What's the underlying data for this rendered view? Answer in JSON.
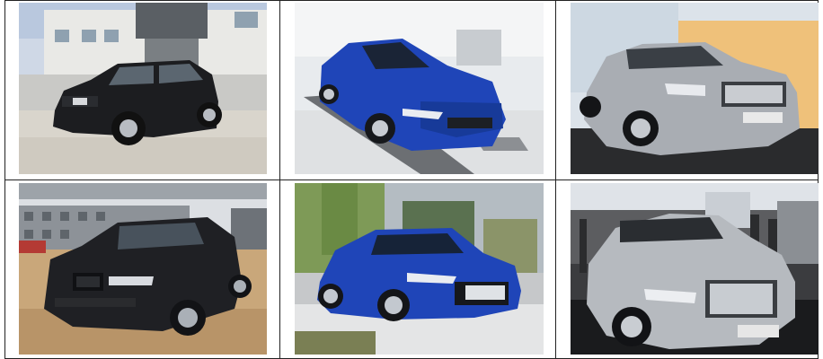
{
  "photos": [
    {
      "subject": "black-suv-courtyard",
      "plate": ""
    },
    {
      "subject": "blue-sedan-showroom",
      "plate": ""
    },
    {
      "subject": "silver-sedan-showroom",
      "plate": ""
    },
    {
      "subject": "black-suv-lot",
      "plate": ""
    },
    {
      "subject": "blue-sedan-street",
      "plate": ""
    },
    {
      "subject": "silver-luxury-sedan-show",
      "plate": ""
    }
  ],
  "colors": {
    "grid_line": "#222222",
    "car_black": "#1c1d20",
    "car_blue": "#1f45b8",
    "car_silver": "#a9adb3"
  }
}
